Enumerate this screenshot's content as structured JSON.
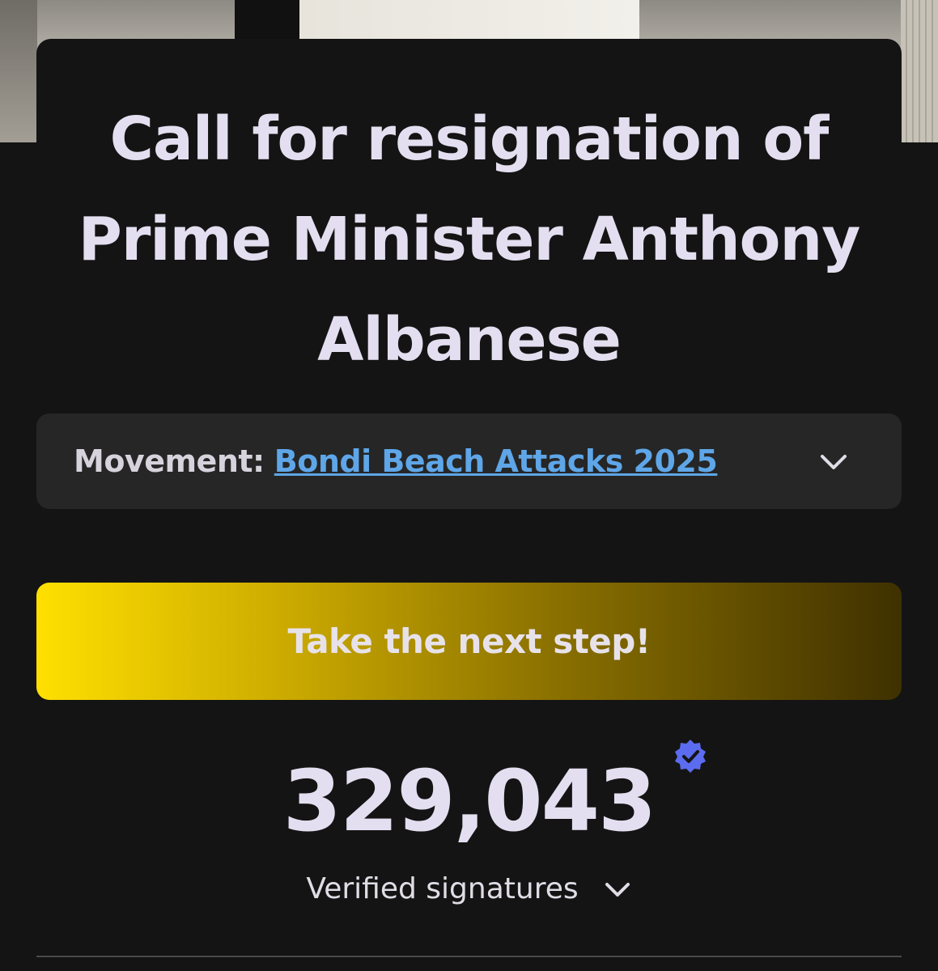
{
  "petition": {
    "title": "Call for resignation of Prime Minister Anthony Albanese"
  },
  "movement": {
    "label": "Movement:",
    "link_text": "Bondi Beach Attacks 2025",
    "link_color": "#5ea6e8",
    "toggle_icon": "chevron-down-icon"
  },
  "cta": {
    "label": "Take the next step!",
    "gradient_start": "#ffe000",
    "gradient_end": "#3f3100"
  },
  "signatures": {
    "count": "329,043",
    "label": "Verified signatures",
    "badge_icon": "verified-badge-icon",
    "badge_color": "#5b6cf0",
    "toggle_icon": "chevron-down-icon"
  }
}
